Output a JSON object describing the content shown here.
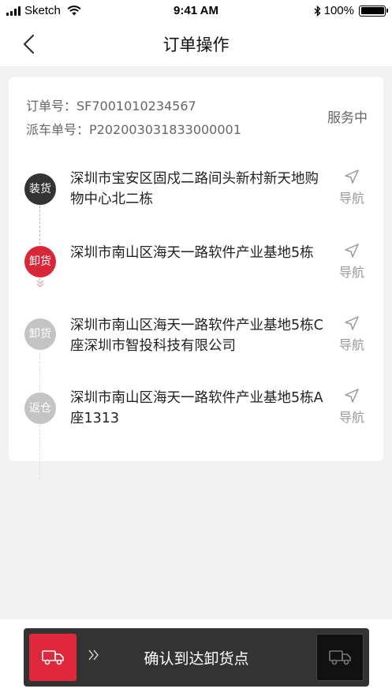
{
  "status_bar": {
    "carrier": "Sketch",
    "time": "9:41 AM",
    "battery_text": "100%",
    "battery_level": 1.0
  },
  "header": {
    "title": "订单操作"
  },
  "order": {
    "order_no_label": "订单号：",
    "order_no": "SF7001010234567",
    "dispatch_no_label": "派车单号：",
    "dispatch_no": "P202003031833000001",
    "status": "服务中"
  },
  "stops": [
    {
      "badge": "装货",
      "address": "深圳市宝安区固戍二路间头新村新天地购物中心北二栋",
      "action": "导航",
      "state": "done",
      "color": "#333333"
    },
    {
      "badge": "卸货",
      "address": "深圳市南山区海天一路软件产业基地5栋",
      "action": "导航",
      "state": "current",
      "color": "#d9273a"
    },
    {
      "badge": "卸货",
      "address": "深圳市南山区海天一路软件产业基地5栋C座深圳市智投科技有限公司",
      "action": "导航",
      "state": "pending",
      "color": "#c4c4c4"
    },
    {
      "badge": "返仓",
      "address": "深圳市南山区海天一路软件产业基地5栋A座1313",
      "action": "导航",
      "state": "pending",
      "color": "#c4c4c4"
    }
  ],
  "bottom": {
    "slide_text": "确认到达卸货点",
    "handle_icon": "truck-icon",
    "target_icon": "truck-icon",
    "accent": "#e0283c"
  }
}
